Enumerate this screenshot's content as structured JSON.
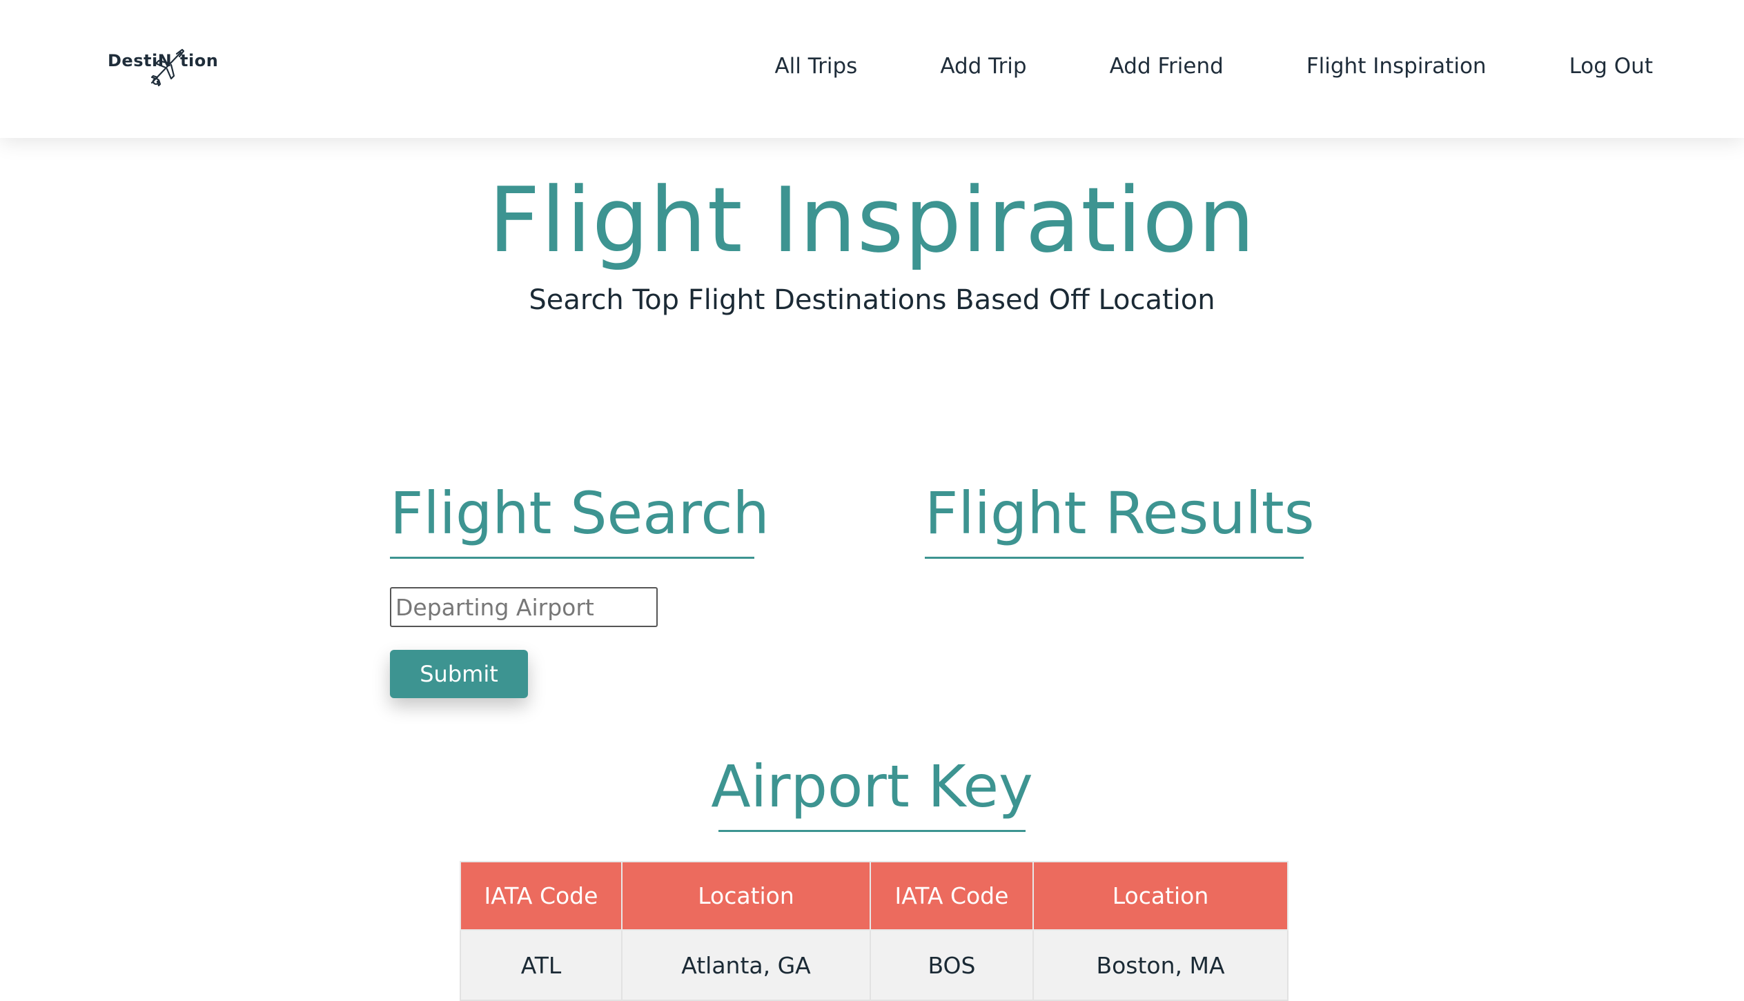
{
  "brand": {
    "logo_left": "DestiN",
    "logo_right": "tion"
  },
  "nav": {
    "items": [
      {
        "label": "All Trips"
      },
      {
        "label": "Add Trip"
      },
      {
        "label": "Add Friend"
      },
      {
        "label": "Flight Inspiration"
      },
      {
        "label": "Log Out"
      }
    ]
  },
  "hero": {
    "title": "Flight Inspiration",
    "subtitle": "Search Top Flight Destinations Based Off Location"
  },
  "flight_search": {
    "heading": "Flight Search",
    "input_placeholder": "Departing Airport",
    "input_value": "",
    "submit_label": "Submit"
  },
  "flight_results": {
    "heading": "Flight Results"
  },
  "airport_key": {
    "heading": "Airport Key",
    "columns": [
      "IATA Code",
      "Location",
      "IATA Code",
      "Location"
    ],
    "rows": [
      [
        "ATL",
        "Atlanta, GA",
        "BOS",
        "Boston, MA"
      ]
    ]
  },
  "colors": {
    "accent": "#3d9491",
    "table_header": "#ec6b5e",
    "table_cell": "#f1f1f1",
    "text": "#1b2a35"
  }
}
